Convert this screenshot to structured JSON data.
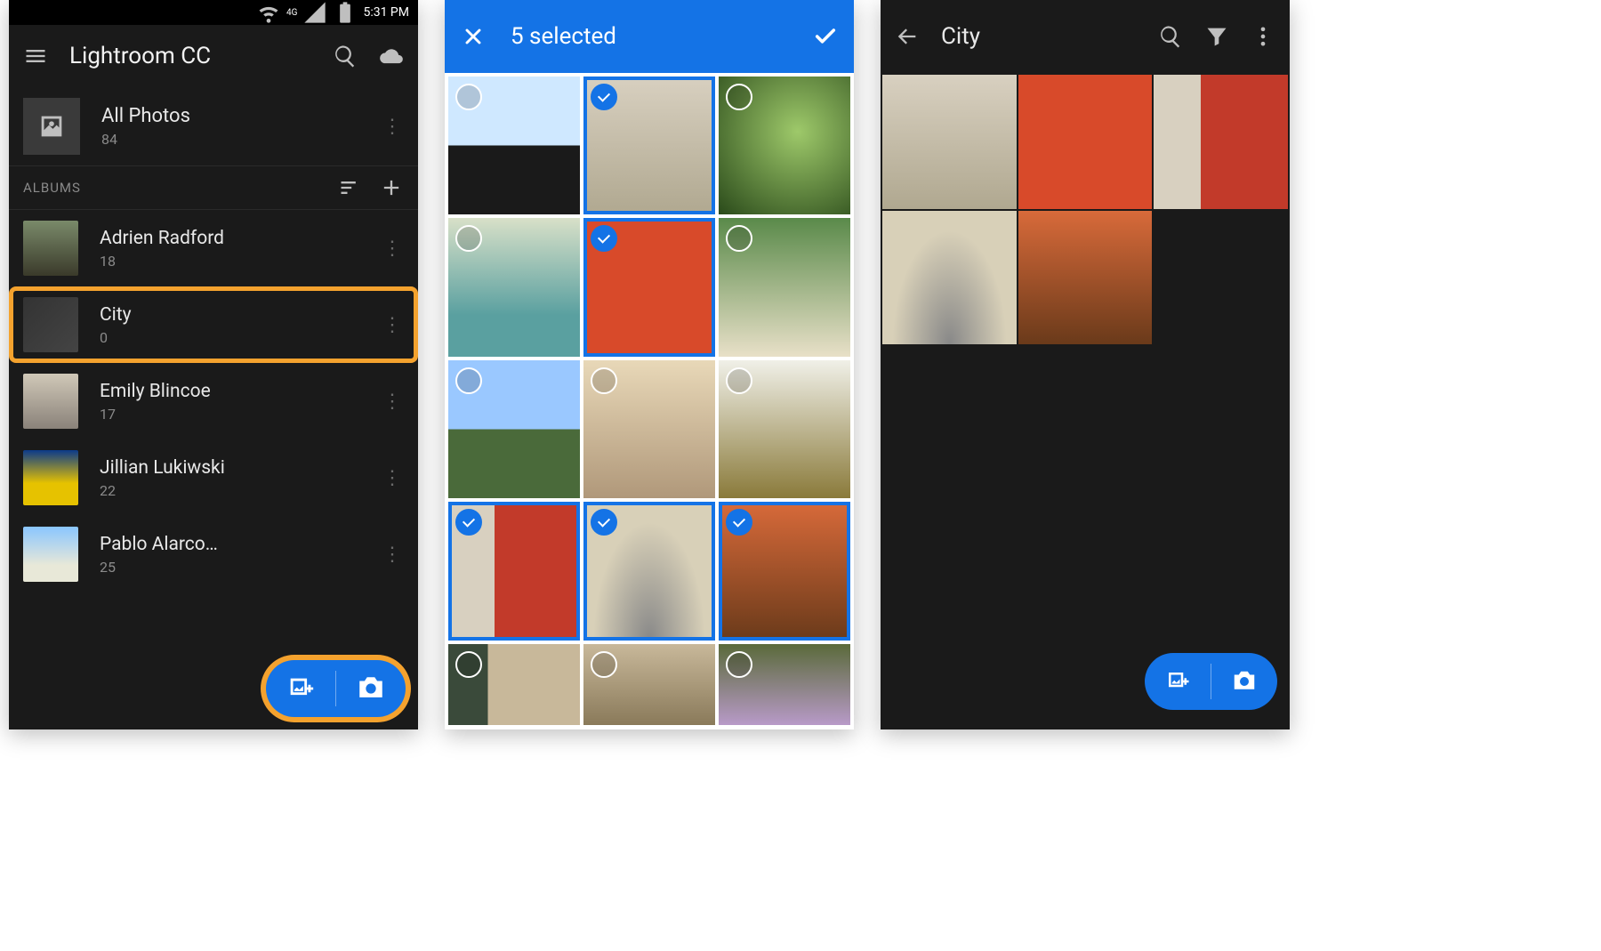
{
  "status": {
    "time": "5:31 PM",
    "net": "4G"
  },
  "screen1": {
    "app_title": "Lightroom CC",
    "all_photos_label": "All Photos",
    "all_photos_count": "84",
    "section_label": "ALBUMS",
    "albums": [
      {
        "name": "Adrien Radford",
        "count": "18",
        "highlight": false
      },
      {
        "name": "City",
        "count": "0",
        "highlight": true
      },
      {
        "name": "Emily Blincoe",
        "count": "17",
        "highlight": false
      },
      {
        "name": "Jillian Lukiwski",
        "count": "22",
        "highlight": false
      },
      {
        "name": "Pablo Alarco…",
        "count": "25",
        "highlight": false
      }
    ],
    "fab_highlight": true
  },
  "screen2": {
    "selected_label": "5 selected",
    "grid": [
      {
        "s": false,
        "c": "g-diver"
      },
      {
        "s": true,
        "c": "g-tv"
      },
      {
        "s": false,
        "c": "g-salad"
      },
      {
        "s": false,
        "c": "g-kitchen"
      },
      {
        "s": true,
        "c": "g-redwall"
      },
      {
        "s": false,
        "c": "g-porch"
      },
      {
        "s": false,
        "c": "g-cotton"
      },
      {
        "s": false,
        "c": "g-polaroid"
      },
      {
        "s": false,
        "c": "g-coffee"
      },
      {
        "s": true,
        "c": "g-reddoor"
      },
      {
        "s": true,
        "c": "g-road"
      },
      {
        "s": true,
        "c": "g-autumn"
      },
      {
        "s": false,
        "c": "g-living",
        "last": true
      },
      {
        "s": false,
        "c": "g-room",
        "last": true
      },
      {
        "s": false,
        "c": "g-flowers",
        "last": true
      }
    ]
  },
  "screen3": {
    "title": "City",
    "grid": [
      {
        "c": "g-tv"
      },
      {
        "c": "g-redwall"
      },
      {
        "c": "g-reddoor"
      },
      {
        "c": "g-road"
      },
      {
        "c": "g-autumn"
      }
    ]
  },
  "accent": "#1473e6",
  "highlight": "#f4a22e"
}
